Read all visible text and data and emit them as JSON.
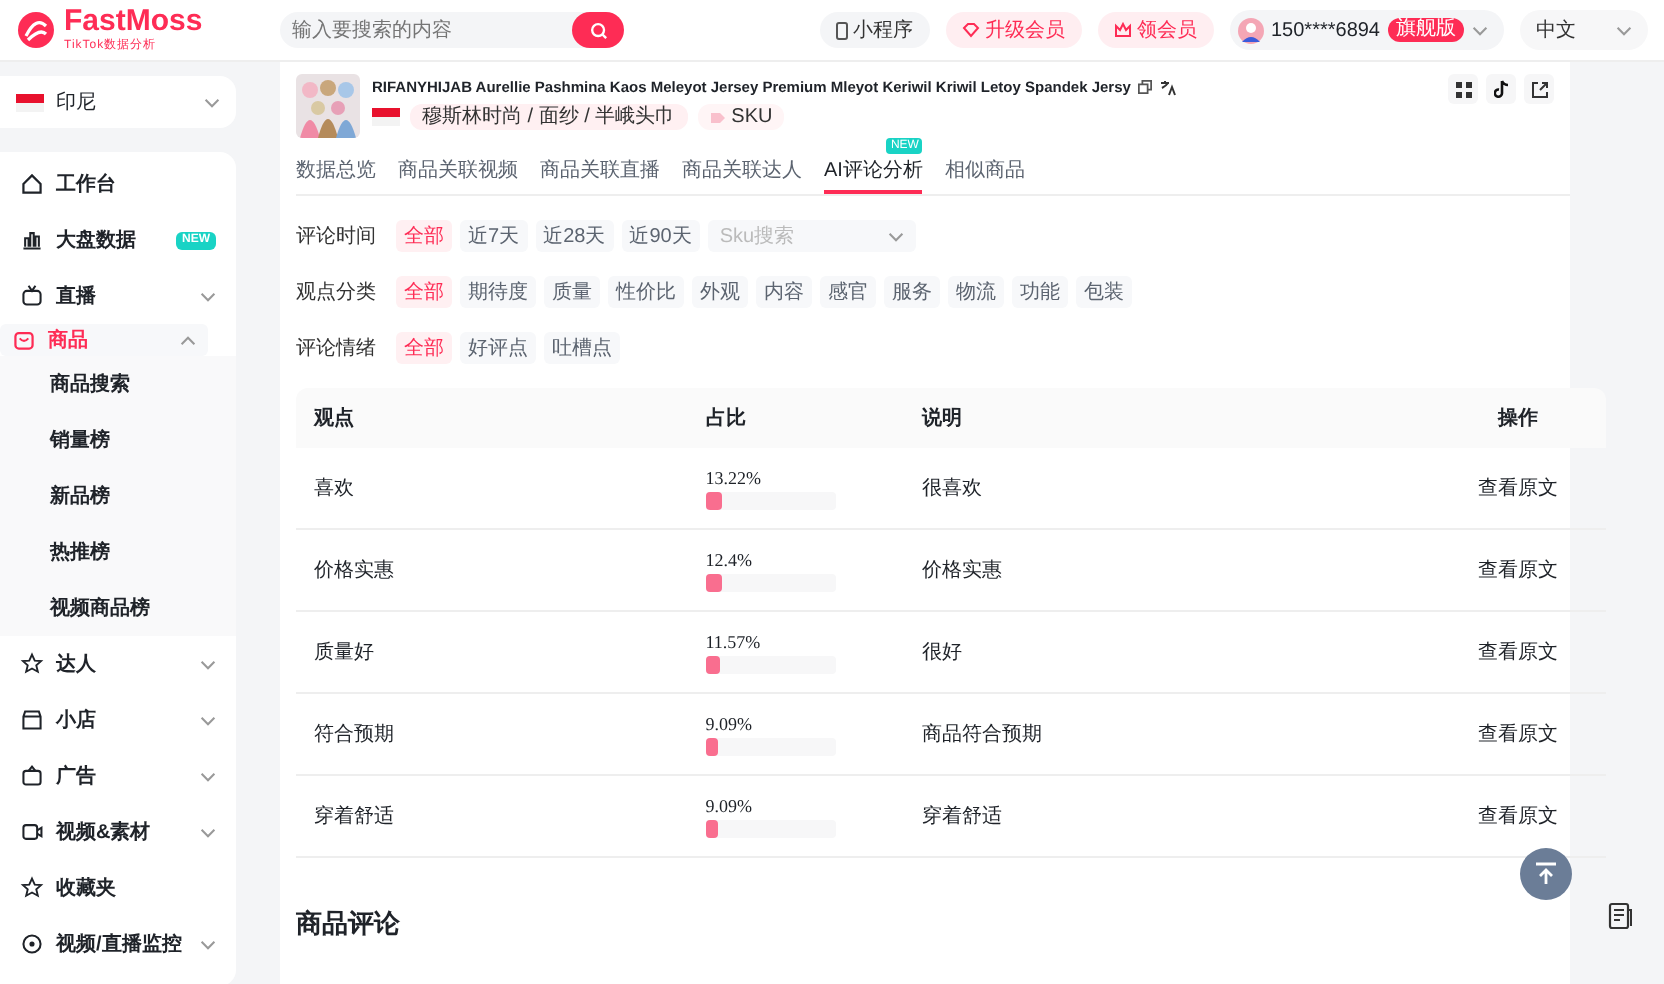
{
  "header": {
    "logo": "FastMoss",
    "logo_sub": "TikTok数据分析",
    "search": {
      "placeholder": "输入要搜索的内容"
    },
    "actions": [
      {
        "kind": "mini",
        "label": "小程序"
      },
      {
        "kind": "upgrade",
        "label": "升级会员"
      },
      {
        "kind": "gift",
        "label": "领会员"
      }
    ],
    "user": {
      "phone": "150****6894",
      "badge": "旗舰版"
    },
    "language": "中文"
  },
  "sidebar": {
    "region": "印尼",
    "items": [
      {
        "label": "工作台",
        "selected": false
      },
      {
        "label": "大盘数据",
        "badge": "NEW",
        "selected": false
      },
      {
        "label": "直播",
        "expanded": false,
        "selected": false
      },
      {
        "label": "商品",
        "expanded": true,
        "selected": true,
        "children": [
          {
            "label": "商品搜索"
          },
          {
            "label": "销量榜"
          },
          {
            "label": "新品榜"
          },
          {
            "label": "热推榜"
          },
          {
            "label": "视频商品榜"
          }
        ]
      },
      {
        "label": "达人",
        "expanded": false,
        "selected": false
      },
      {
        "label": "小店",
        "expanded": false,
        "selected": false
      },
      {
        "label": "广告",
        "expanded": false,
        "selected": false
      },
      {
        "label": "视频&素材",
        "expanded": false,
        "selected": false
      },
      {
        "label": "收藏夹",
        "selected": false
      },
      {
        "label": "视频/直播监控",
        "expanded": false,
        "selected": false
      }
    ]
  },
  "product": {
    "title": "RIFANYHIJAB Aurellie Pashmina Kaos Meleyot Jersey Premium Mleyot Keriwil Kriwil Letoy Spandek Jersy",
    "category": "穆斯林时尚 / 面纱 / 半峨头巾",
    "sku": "SKU"
  },
  "tabs": [
    {
      "label": "数据总览",
      "selected": false
    },
    {
      "label": "商品关联视频",
      "selected": false
    },
    {
      "label": "商品关联直播",
      "selected": false
    },
    {
      "label": "商品关联达人",
      "selected": false
    },
    {
      "label": "AI评论分析",
      "selected": true,
      "badge": "NEW"
    },
    {
      "label": "相似商品",
      "selected": false
    }
  ],
  "filters": [
    {
      "label": "评论时间",
      "options": [
        {
          "label": "全部",
          "selected": true
        },
        {
          "label": "近7天",
          "selected": false
        },
        {
          "label": "近28天",
          "selected": false
        },
        {
          "label": "近90天",
          "selected": false
        }
      ],
      "select_placeholder": "Sku搜索"
    },
    {
      "label": "观点分类",
      "options": [
        {
          "label": "全部",
          "selected": true
        },
        {
          "label": "期待度",
          "selected": false
        },
        {
          "label": "质量",
          "selected": false
        },
        {
          "label": "性价比",
          "selected": false
        },
        {
          "label": "外观",
          "selected": false
        },
        {
          "label": "内容",
          "selected": false
        },
        {
          "label": "感官",
          "selected": false
        },
        {
          "label": "服务",
          "selected": false
        },
        {
          "label": "物流",
          "selected": false
        },
        {
          "label": "功能",
          "selected": false
        },
        {
          "label": "包装",
          "selected": false
        }
      ]
    },
    {
      "label": "评论情绪",
      "options": [
        {
          "label": "全部",
          "selected": true
        },
        {
          "label": "好评点",
          "selected": false
        },
        {
          "label": "吐槽点",
          "selected": false
        }
      ]
    }
  ],
  "table": {
    "columns": [
      "观点",
      "占比",
      "说明",
      "操作"
    ],
    "rows": [
      {
        "point": "喜欢",
        "share": "13.22%",
        "level": 0.1322,
        "note": "很喜欢",
        "action": "查看原文"
      },
      {
        "point": "价格实惠",
        "share": "12.4%",
        "level": 0.124,
        "note": "价格实惠",
        "action": "查看原文"
      },
      {
        "point": "质量好",
        "share": "11.57%",
        "level": 0.1157,
        "note": "很好",
        "action": "查看原文"
      },
      {
        "point": "符合预期",
        "share": "9.09%",
        "level": 0.0909,
        "note": "商品符合预期",
        "action": "查看原文"
      },
      {
        "point": "穿着舒适",
        "share": "9.09%",
        "level": 0.0909,
        "note": "穿着舒适",
        "action": "查看原文"
      }
    ]
  },
  "reviews_title": "商品评论"
}
